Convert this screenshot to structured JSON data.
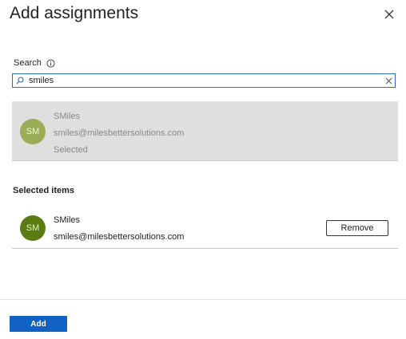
{
  "panel": {
    "title": "Add assignments"
  },
  "search": {
    "label": "Search",
    "value": "smiles",
    "placeholder": ""
  },
  "results": [
    {
      "initials": "SM",
      "name": "SMiles",
      "email": "smiles@milesbettersolutions.com",
      "status": "Selected"
    }
  ],
  "selected": {
    "heading": "Selected items",
    "items": [
      {
        "initials": "SM",
        "name": "SMiles",
        "email": "smiles@milesbettersolutions.com",
        "remove_label": "Remove"
      }
    ]
  },
  "footer": {
    "add_label": "Add"
  },
  "colors": {
    "accent": "#1261c5",
    "result_bg": "#e1dfdd",
    "result_avatar": "#9aac55",
    "selected_avatar": "#5a7d13"
  },
  "icons": {
    "close": "close-icon",
    "info": "info-icon",
    "search": "search-icon",
    "clear": "clear-icon"
  }
}
